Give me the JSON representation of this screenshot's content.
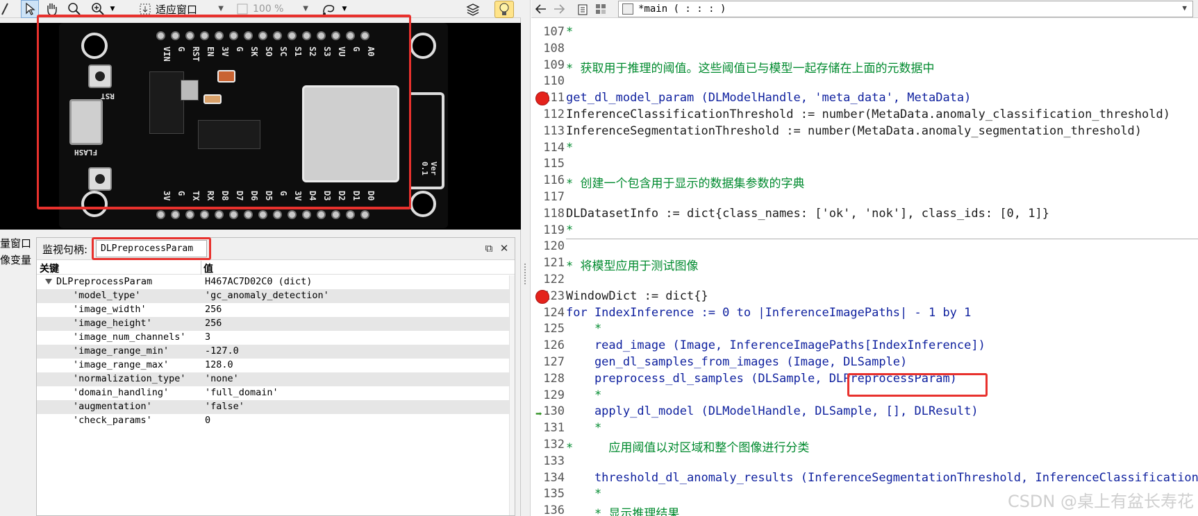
{
  "toolbar_left": {
    "zoom_mode": "适应窗口",
    "zoom_percent": "100 %"
  },
  "board_silkscreen": {
    "top_pins": [
      "VIN",
      "G",
      "RST",
      "EN",
      "3V",
      "G",
      "SK",
      "SO",
      "SC",
      "S1",
      "S2",
      "S3",
      "VU",
      "G",
      "A0"
    ],
    "bottom_pins": [
      "3V",
      "G",
      "TX",
      "RX",
      "D8",
      "D7",
      "D6",
      "D5",
      "G",
      "3V",
      "D4",
      "D3",
      "D2",
      "D1",
      "D0"
    ],
    "labels": [
      "RST",
      "FLASH",
      "Ver 0.1"
    ]
  },
  "watch": {
    "side_tabs": [
      "量窗口",
      "像变量"
    ],
    "handle_label": "监视句柄:",
    "handle_value": "DLPreprocessParam",
    "col_key": "关键",
    "col_value": "值",
    "root": {
      "key": "DLPreprocessParam",
      "value": "H467AC7D02C0 (dict)"
    },
    "entries": [
      {
        "key": "'model_type'",
        "value": "'gc_anomaly_detection'"
      },
      {
        "key": "'image_width'",
        "value": "256"
      },
      {
        "key": "'image_height'",
        "value": "256"
      },
      {
        "key": "'image_num_channels'",
        "value": "3"
      },
      {
        "key": "'image_range_min'",
        "value": "-127.0"
      },
      {
        "key": "'image_range_max'",
        "value": "128.0"
      },
      {
        "key": "'normalization_type'",
        "value": "'none'"
      },
      {
        "key": "'domain_handling'",
        "value": "'full_domain'"
      },
      {
        "key": "'augmentation'",
        "value": "'false'"
      },
      {
        "key": "'check_params'",
        "value": "0"
      }
    ]
  },
  "editor": {
    "procedure": "*main ( : : : )",
    "lines": [
      {
        "n": "107",
        "t": "*",
        "c": "cmt"
      },
      {
        "n": "108",
        "t": "",
        "c": "plain"
      },
      {
        "n": "109",
        "t": "* 获取用于推理的阈值。这些阈值已与模型一起存储在上面的元数据中",
        "c": "cmt"
      },
      {
        "n": "110",
        "t": "",
        "c": "plain"
      },
      {
        "n": "111",
        "t": "get_dl_model_param (DLModelHandle, 'meta_data', MetaData)",
        "c": "kw",
        "bp": true
      },
      {
        "n": "112",
        "t": "InferenceClassificationThreshold := number(MetaData.anomaly_classification_threshold)",
        "c": "plain"
      },
      {
        "n": "113",
        "t": "InferenceSegmentationThreshold := number(MetaData.anomaly_segmentation_threshold)",
        "c": "plain"
      },
      {
        "n": "114",
        "t": "*",
        "c": "cmt"
      },
      {
        "n": "115",
        "t": "",
        "c": "plain"
      },
      {
        "n": "116",
        "t": "* 创建一个包含用于显示的数据集参数的字典",
        "c": "cmt"
      },
      {
        "n": "117",
        "t": "",
        "c": "plain"
      },
      {
        "n": "118",
        "t": "DLDatasetInfo := dict{class_names: ['ok', 'nok'], class_ids: [0, 1]}",
        "c": "plain"
      },
      {
        "n": "119",
        "t": "*",
        "c": "cmt"
      },
      {
        "n": "120",
        "t": "",
        "c": "plain"
      },
      {
        "n": "121",
        "t": "* 将模型应用于测试图像",
        "c": "cmt"
      },
      {
        "n": "122",
        "t": "",
        "c": "plain"
      },
      {
        "n": "123",
        "t": "WindowDict := dict{}",
        "c": "plain",
        "bp": true
      },
      {
        "n": "124",
        "t": "for IndexInference := 0 to |InferenceImagePaths| - 1 by 1",
        "c": "kw"
      },
      {
        "n": "125",
        "t": "    *",
        "c": "cmt"
      },
      {
        "n": "126",
        "t": "    read_image (Image, InferenceImagePaths[IndexInference])",
        "c": "kw"
      },
      {
        "n": "127",
        "t": "    gen_dl_samples_from_images (Image, DLSample)",
        "c": "kw"
      },
      {
        "n": "128",
        "t": "    preprocess_dl_samples (DLSample, DLPreprocessParam)",
        "c": "kw"
      },
      {
        "n": "129",
        "t": "    *",
        "c": "cmt"
      },
      {
        "n": "130",
        "t": "    apply_dl_model (DLModelHandle, DLSample, [], DLResult)",
        "c": "kw",
        "pc": true
      },
      {
        "n": "131",
        "t": "    *",
        "c": "cmt"
      },
      {
        "n": "132",
        "t": "*     应用阈值以对区域和整个图像进行分类",
        "c": "cmt"
      },
      {
        "n": "133",
        "t": "",
        "c": "plain"
      },
      {
        "n": "134",
        "t": "    threshold_dl_anomaly_results (InferenceSegmentationThreshold, InferenceClassificationThreshold, DLResult)",
        "c": "kw"
      },
      {
        "n": "135",
        "t": "    *",
        "c": "cmt"
      },
      {
        "n": "136",
        "t": "    * 显示推理结果",
        "c": "cmt"
      }
    ]
  },
  "watermark": "CSDN @桌上有盆长寿花",
  "colors": {
    "highlight_box": "#e8312d",
    "comment": "#008a2e",
    "keyword": "#0d1f9e",
    "breakpoint": "#e4221b"
  }
}
